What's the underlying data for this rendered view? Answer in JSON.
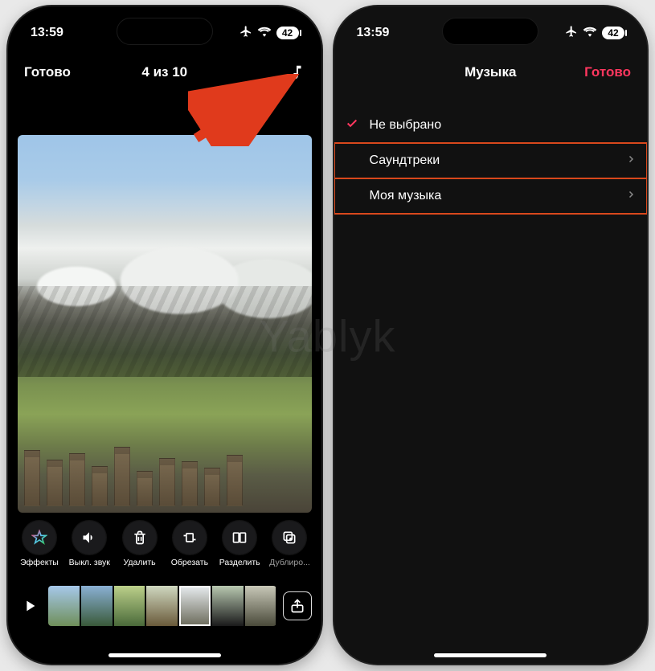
{
  "status": {
    "time": "13:59",
    "battery": "42"
  },
  "screen1": {
    "nav": {
      "done": "Готово",
      "counter": "4 из 10"
    },
    "toolbar": {
      "effects": "Эффекты",
      "mute": "Выкл. звук",
      "delete": "Удалить",
      "crop": "Обрезать",
      "split": "Разделить",
      "duplicate": "Дублиро..."
    }
  },
  "screen2": {
    "nav": {
      "title": "Музыка",
      "done": "Готово"
    },
    "rows": {
      "none": "Не выбрано",
      "soundtracks": "Саундтреки",
      "mymusic": "Моя музыка"
    }
  },
  "watermark": "Yablyk"
}
